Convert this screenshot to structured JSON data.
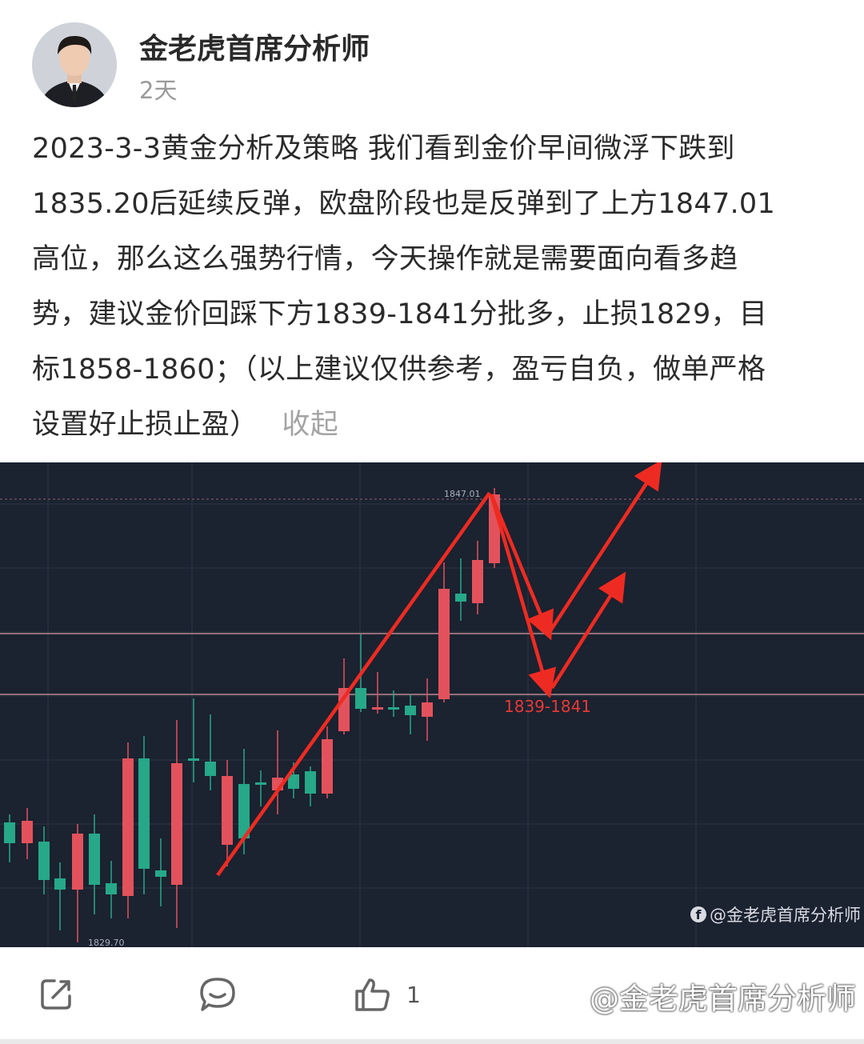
{
  "author": {
    "name": "金老虎首席分析师",
    "time": "2天"
  },
  "post": {
    "lines": [
      "2023-3-3黄金分析及策略 我们看到金价早间微浮下跌到",
      "1835.20后延续反弹，欧盘阶段也是反弹到了上方1847.01",
      "高位，那么这么强势行情，今天操作就是需要面向看多趋",
      "势，建议金价回踩下方1839-1841分批多，止损1829，目",
      "标1858-1860；（以上建议仅供参考，盈亏自负，做单严格",
      "设置好止损止盈）"
    ],
    "collapse_label": "收起"
  },
  "chart_image": {
    "high_label": "1847.01",
    "low_label": "1829.70",
    "zone_label": "1839-1841",
    "watermark": "@金老虎首席分析师",
    "colors": {
      "background": "#1b2230",
      "up": "#e3525c",
      "down": "#26a889",
      "arrow": "#ee2b22"
    }
  },
  "chart_data": {
    "type": "candlestick",
    "annotations": [
      "1847.01",
      "1829.70",
      "1839-1841"
    ],
    "series": [
      {
        "name": "",
        "values": []
      }
    ]
  },
  "actions": {
    "share_icon": "share-icon",
    "comment_icon": "comment-icon",
    "like_icon": "thumbs-up-icon",
    "like_count": "1"
  },
  "footer": {
    "watermark": "@金老虎首席分析师"
  }
}
